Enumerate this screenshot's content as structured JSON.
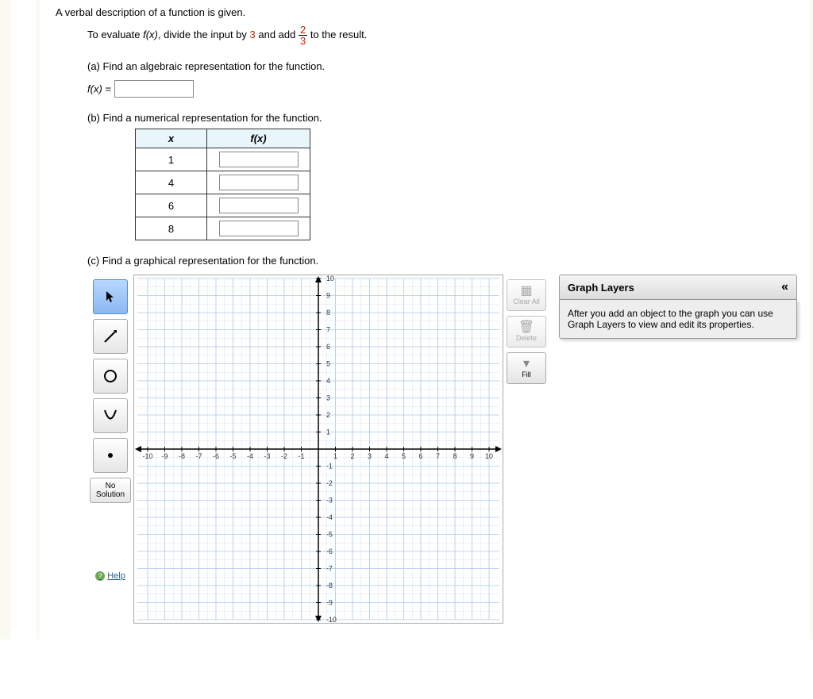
{
  "intro": "A verbal description of a function is given.",
  "description": {
    "prefix": "To evaluate ",
    "fx_i": "f(x)",
    "mid1": ", divide the input by ",
    "divisor": "3",
    "mid2": " and add ",
    "frac_num": "2",
    "frac_den": "3",
    "suffix": " to the result."
  },
  "parts": {
    "a": {
      "prompt": "(a) Find an algebraic representation for the function.",
      "label_l": "f",
      "label_r": "(x) ="
    },
    "b": {
      "prompt": "(b) Find a numerical representation for the function.",
      "headers": {
        "x": "x",
        "fx": "f(x)"
      },
      "rows": [
        "1",
        "4",
        "6",
        "8"
      ]
    },
    "c": {
      "prompt": "(c) Find a graphical representation for the function."
    }
  },
  "graph": {
    "axis_ticks_pos": [
      "1",
      "2",
      "3",
      "4",
      "5",
      "6",
      "7",
      "8",
      "9",
      "10"
    ],
    "axis_ticks_neg": [
      "-1",
      "-2",
      "-3",
      "-4",
      "-5",
      "-6",
      "-7",
      "-8",
      "-9",
      "-10"
    ]
  },
  "tools": {
    "no_solution": "No Solution",
    "help": "Help"
  },
  "right_tools": {
    "clear": "Clear All",
    "delete": "Delete",
    "fill": "Fill"
  },
  "layers": {
    "title": "Graph Layers",
    "collapse": "«",
    "body": "After you add an object to the graph you can use Graph Layers to view and edit its properties."
  },
  "chart_data": {
    "type": "line",
    "title": "",
    "xlabel": "",
    "ylabel": "",
    "xlim": [
      -10,
      10
    ],
    "ylim": [
      -10,
      10
    ],
    "x_ticks": [
      -10,
      -9,
      -8,
      -7,
      -6,
      -5,
      -4,
      -3,
      -2,
      -1,
      1,
      2,
      3,
      4,
      5,
      6,
      7,
      8,
      9,
      10
    ],
    "y_ticks": [
      -10,
      -9,
      -8,
      -7,
      -6,
      -5,
      -4,
      -3,
      -2,
      -1,
      1,
      2,
      3,
      4,
      5,
      6,
      7,
      8,
      9,
      10
    ],
    "grid": true,
    "series": []
  }
}
